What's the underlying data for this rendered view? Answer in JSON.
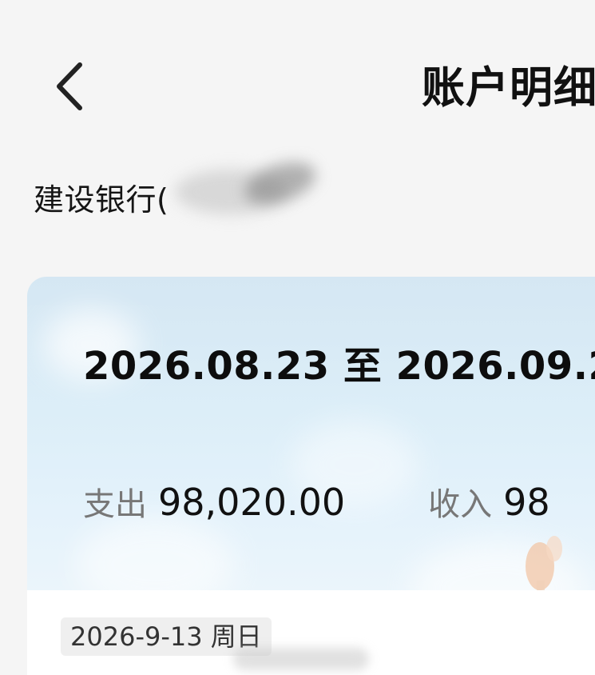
{
  "header": {
    "title": "账户明细",
    "back_icon": "chevron-left-icon"
  },
  "account": {
    "bank_name": "建设银行("
  },
  "summary": {
    "date_range": "2026.08.23 至 2026.09.2",
    "expense_label": "支出",
    "expense_value": "98,020.00",
    "income_label": "收入",
    "income_value": "98"
  },
  "transactions": {
    "date_chip": "2026-9-13 周日"
  },
  "colors": {
    "background": "#f5f5f5",
    "card_top": "#d5e7f3",
    "card_bottom": "#edf6fb",
    "label_gray": "#777777"
  }
}
